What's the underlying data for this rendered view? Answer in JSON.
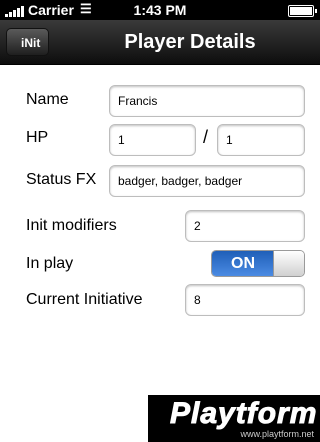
{
  "status_bar": {
    "carrier": "Carrier",
    "time": "1:43 PM"
  },
  "nav": {
    "back_label": "iNit",
    "title": "Player Details"
  },
  "form": {
    "name_label": "Name",
    "name_value": "Francis",
    "hp_label": "HP",
    "hp_current": "1",
    "hp_separator": "/",
    "hp_max": "1",
    "status_label": "Status FX",
    "status_value": "badger, badger, badger",
    "init_mod_label": "Init modifiers",
    "init_mod_value": "2",
    "in_play_label": "In play",
    "in_play_state": "ON",
    "current_init_label": "Current Initiative",
    "current_init_value": "8"
  },
  "watermark": {
    "logo": "Playtform",
    "url": "www.playtform.net"
  },
  "colors": {
    "toggle_on": "#3a78d6",
    "nav_bar": "#1a1a1a"
  },
  "icons": [
    "signal-icon",
    "wifi-icon",
    "battery-icon",
    "back-arrow-icon"
  ]
}
